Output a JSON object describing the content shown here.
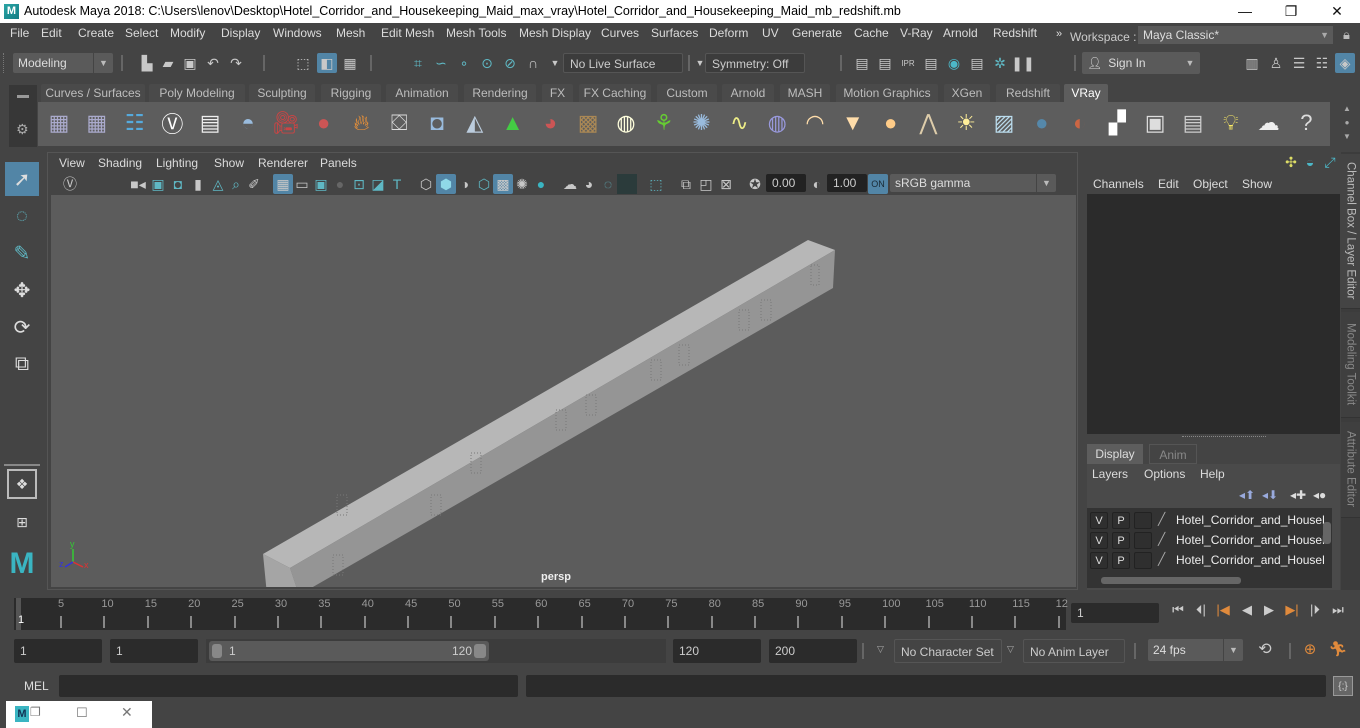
{
  "window": {
    "title": "Autodesk Maya 2018: C:\\Users\\lenov\\Desktop\\Hotel_Corridor_and_Housekeeping_Maid_max_vray\\Hotel_Corridor_and_Housekeeping_Maid_mb_redshift.mb",
    "logo": "M",
    "minimize": "—",
    "maximize": "❐",
    "close": "✕"
  },
  "menubar": {
    "items": [
      "File",
      "Edit",
      "Create",
      "Select",
      "Modify",
      "Display",
      "Windows",
      "Mesh",
      "Edit Mesh",
      "Mesh Tools",
      "Mesh Display",
      "Curves",
      "Surfaces",
      "Deform",
      "UV",
      "Generate",
      "Cache",
      "V-Ray",
      "Arnold",
      "Redshift"
    ],
    "overflow": "»",
    "workspace_label": "Workspace :",
    "workspace_value": "Maya Classic*"
  },
  "statusline": {
    "mode": "Modeling",
    "live_surface": "No Live Surface",
    "symmetry": "Symmetry: Off",
    "sign_in": "Sign In"
  },
  "shelf": {
    "tabs": [
      "Curves / Surfaces",
      "Poly Modeling",
      "Sculpting",
      "Rigging",
      "Animation",
      "Rendering",
      "FX",
      "FX Caching",
      "Custom",
      "Arnold",
      "MASH",
      "Motion Graphics",
      "XGen",
      "Redshift",
      "VRay"
    ],
    "active_tab": "VRay",
    "icons": [
      "vray-export-icon",
      "vray-import-icon",
      "vray-list-icon",
      "vray-logo-icon",
      "vray-doc-icon",
      "vray-material-icon",
      "vray-camera-icon",
      "vray-spheres-icon",
      "vray-fire-icon",
      "vray-mesh-icon",
      "vray-proxy-icon",
      "vray-cone-icon",
      "vray-light-cone-icon",
      "vray-sphere-fade-icon",
      "vray-texture-icon",
      "vray-dome-icon",
      "vray-fur-icon",
      "vray-particles-icon",
      "vray-curve-icon",
      "vray-globe-icon",
      "vray-light-dome-icon",
      "vray-spot-icon",
      "vray-sphere-light-icon",
      "vray-ies-icon",
      "vray-sun-icon",
      "vray-plane-icon",
      "vray-ball-icon",
      "vray-stripes-icon",
      "vray-checker-icon",
      "vray-framebuffer-icon",
      "vray-settings-icon",
      "vray-light-editor-icon",
      "vray-cloud-icon",
      "help-icon"
    ]
  },
  "toolbox": {
    "tools": [
      "select-tool",
      "lasso-tool",
      "paint-select-tool",
      "move-tool",
      "rotate-tool",
      "scale-tool"
    ]
  },
  "viewport": {
    "menu": [
      "View",
      "Shading",
      "Lighting",
      "Show",
      "Renderer",
      "Panels"
    ],
    "exposure": "0.00",
    "gamma": "1.00",
    "color_space": "sRGB gamma",
    "camera_label": "persp",
    "axis": {
      "x": "x",
      "y": "y",
      "z": "z"
    }
  },
  "channelbox": {
    "menu": [
      "Channels",
      "Edit",
      "Object",
      "Show"
    ],
    "side_tabs": [
      "Channel Box / Layer Editor",
      "Modeling Toolkit",
      "Attribute Editor"
    ]
  },
  "layers": {
    "tabs": [
      "Display",
      "Anim"
    ],
    "menu": [
      "Layers",
      "Options",
      "Help"
    ],
    "rows": [
      {
        "v": "V",
        "p": "P",
        "name": "Hotel_Corridor_and_Housek"
      },
      {
        "v": "V",
        "p": "P",
        "name": "Hotel_Corridor_and_Housek"
      },
      {
        "v": "V",
        "p": "P",
        "name": "Hotel_Corridor_and_Housek"
      }
    ]
  },
  "timeline": {
    "ticks": [
      "5",
      "10",
      "15",
      "20",
      "25",
      "30",
      "35",
      "40",
      "45",
      "50",
      "55",
      "60",
      "65",
      "70",
      "75",
      "80",
      "85",
      "90",
      "95",
      "100",
      "105",
      "110",
      "115",
      "12"
    ],
    "current_marker": "1",
    "current_frame": "1",
    "range_start": 1,
    "range_end": 120,
    "playback_start": "1",
    "anim_start": "1",
    "slider_min_label": "1",
    "slider_max_label": "120",
    "playback_end": "120",
    "anim_end": "200",
    "character_set": "No Character Set",
    "anim_layer": "No Anim Layer",
    "fps": "24 fps"
  },
  "cmdline": {
    "label": "MEL"
  },
  "colors": {
    "accent": "#5285a6",
    "background": "#444444",
    "viewport": "#5c5c5c",
    "field": "#2b2b2b",
    "key_marker": "#e08a3c"
  }
}
